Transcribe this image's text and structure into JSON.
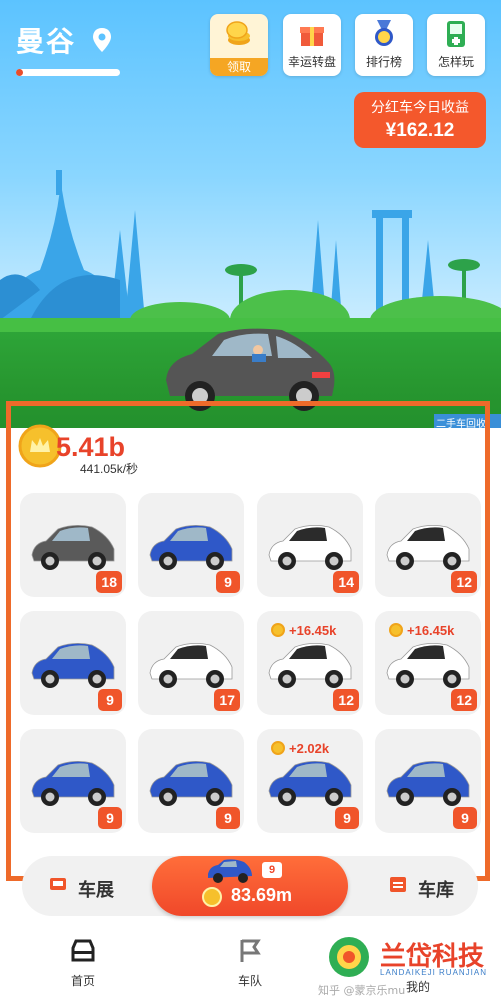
{
  "header": {
    "city": "曼谷",
    "city_progress": 0.06
  },
  "top_buttons": [
    {
      "label": "领取",
      "icon": "coin-stack-icon"
    },
    {
      "label": "幸运转盘",
      "icon": "gift-box-icon"
    },
    {
      "label": "排行榜",
      "icon": "medal-icon"
    },
    {
      "label": "怎样玩",
      "icon": "game-console-icon"
    }
  ],
  "earnings": {
    "title": "分红车今日收益",
    "value": "¥162.12"
  },
  "shop_sign": "二手车回收",
  "balance": {
    "amount": "5.41b",
    "rate": "441.05k/秒"
  },
  "slots": [
    {
      "level": "18",
      "color": "#5a5a5a",
      "gain": ""
    },
    {
      "level": "9",
      "color": "#2f58c8",
      "gain": ""
    },
    {
      "level": "14",
      "color": "#ffffff",
      "gain": ""
    },
    {
      "level": "12",
      "color": "#ffffff",
      "gain": ""
    },
    {
      "level": "9",
      "color": "#2f58c8",
      "gain": ""
    },
    {
      "level": "17",
      "color": "#ffffff",
      "gain": ""
    },
    {
      "level": "12",
      "color": "#ffffff",
      "gain": "+16.45k"
    },
    {
      "level": "12",
      "color": "#ffffff",
      "gain": "+16.45k"
    },
    {
      "level": "9",
      "color": "#2f58c8",
      "gain": ""
    },
    {
      "level": "9",
      "color": "#2f58c8",
      "gain": ""
    },
    {
      "level": "9",
      "color": "#2f58c8",
      "gain": "+2.02k"
    },
    {
      "level": "9",
      "color": "#2f58c8",
      "gain": ""
    }
  ],
  "bottom": {
    "left_label": "车展",
    "right_label": "车库",
    "buy_level": "9",
    "buy_price": "83.69m"
  },
  "nav": [
    {
      "label": "首页",
      "icon": "car-front-icon"
    },
    {
      "label": "车队",
      "icon": "flag-icon"
    },
    {
      "label": "我的",
      "icon": "user-icon"
    }
  ],
  "watermark": {
    "title": "兰岱科技",
    "subtitle": "LANDAIKEJI RUANJIAN",
    "source": "知乎 @蒙京乐mu"
  },
  "colors": {
    "accent": "#f0552a",
    "highlight_border": "#ee6a2a"
  }
}
